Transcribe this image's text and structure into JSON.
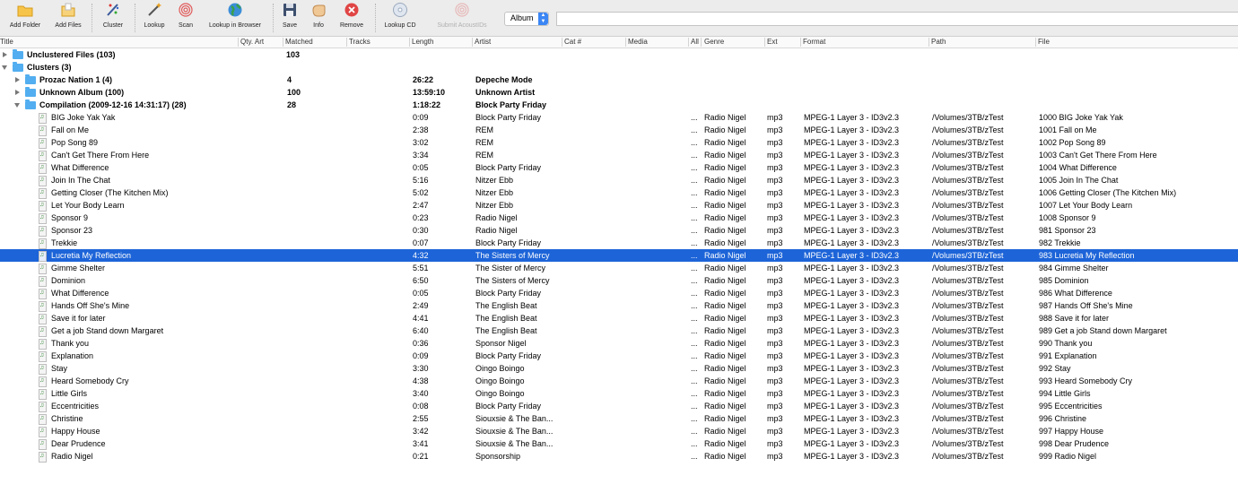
{
  "toolbar": {
    "buttons": [
      {
        "id": "add-folder",
        "label": "Add Folder"
      },
      {
        "id": "add-files",
        "label": "Add Files"
      },
      {
        "id": "cluster",
        "label": "Cluster"
      },
      {
        "id": "lookup",
        "label": "Lookup"
      },
      {
        "id": "scan",
        "label": "Scan"
      },
      {
        "id": "lookup-browser",
        "label": "Lookup in Browser"
      },
      {
        "id": "save",
        "label": "Save"
      },
      {
        "id": "info",
        "label": "Info"
      },
      {
        "id": "remove",
        "label": "Remove"
      },
      {
        "id": "lookup-cd",
        "label": "Lookup CD"
      },
      {
        "id": "submit-acoustids",
        "label": "Submit AcoustIDs"
      }
    ],
    "search_mode": "Album",
    "search_value": ""
  },
  "columns": [
    "Title",
    "Qty. Art",
    "Matched",
    "Tracks",
    "Length",
    "Artist",
    "Cat #",
    "Media",
    "All",
    "Genre",
    "Ext",
    "Format",
    "Path",
    "File"
  ],
  "groups": [
    {
      "title": "Unclustered Files (103)",
      "matched": "103"
    },
    {
      "title": "Clusters (3)"
    },
    {
      "title": "Prozac Nation 1 (4)",
      "qty": "4",
      "length": "26:22",
      "artist": "Depeche Mode"
    },
    {
      "title": "Unknown Album (100)",
      "qty": "100",
      "length": "13:59:10",
      "artist": "Unknown Artist"
    },
    {
      "title": "Compilation (2009-12-16 14:31:17) (28)",
      "qty": "28",
      "length": "1:18:22",
      "artist": "Block Party Friday"
    }
  ],
  "tracks": [
    {
      "title": "BIG Joke Yak Yak",
      "length": "0:09",
      "artist": "Block Party Friday",
      "genre": "Radio Nigel",
      "ext": "mp3",
      "format": "MPEG-1 Layer 3 - ID3v2.3",
      "path": "/Volumes/3TB/zTest",
      "file": "1000 BIG Joke Yak Yak"
    },
    {
      "title": "Fall on Me",
      "length": "2:38",
      "artist": "REM",
      "genre": "Radio Nigel",
      "ext": "mp3",
      "format": "MPEG-1 Layer 3 - ID3v2.3",
      "path": "/Volumes/3TB/zTest",
      "file": "1001 Fall on Me"
    },
    {
      "title": "Pop Song 89",
      "length": "3:02",
      "artist": "REM",
      "genre": "Radio Nigel",
      "ext": "mp3",
      "format": "MPEG-1 Layer 3 - ID3v2.3",
      "path": "/Volumes/3TB/zTest",
      "file": "1002 Pop Song 89"
    },
    {
      "title": "Can't Get There From Here",
      "length": "3:34",
      "artist": "REM",
      "genre": "Radio Nigel",
      "ext": "mp3",
      "format": "MPEG-1 Layer 3 - ID3v2.3",
      "path": "/Volumes/3TB/zTest",
      "file": "1003 Can't Get There From Here"
    },
    {
      "title": "What Difference",
      "length": "0:05",
      "artist": "Block Party Friday",
      "genre": "Radio Nigel",
      "ext": "mp3",
      "format": "MPEG-1 Layer 3 - ID3v2.3",
      "path": "/Volumes/3TB/zTest",
      "file": "1004 What Difference"
    },
    {
      "title": "Join In The Chat",
      "length": "5:16",
      "artist": "Nitzer Ebb",
      "genre": "Radio Nigel",
      "ext": "mp3",
      "format": "MPEG-1 Layer 3 - ID3v2.3",
      "path": "/Volumes/3TB/zTest",
      "file": "1005 Join In The Chat"
    },
    {
      "title": "Getting Closer (The Kitchen Mix)",
      "length": "5:02",
      "artist": "Nitzer Ebb",
      "genre": "Radio Nigel",
      "ext": "mp3",
      "format": "MPEG-1 Layer 3 - ID3v2.3",
      "path": "/Volumes/3TB/zTest",
      "file": "1006 Getting Closer (The Kitchen Mix)"
    },
    {
      "title": "Let Your Body Learn",
      "length": "2:47",
      "artist": "Nitzer Ebb",
      "genre": "Radio Nigel",
      "ext": "mp3",
      "format": "MPEG-1 Layer 3 - ID3v2.3",
      "path": "/Volumes/3TB/zTest",
      "file": "1007 Let Your Body Learn"
    },
    {
      "title": "Sponsor 9",
      "length": "0:23",
      "artist": "Radio Nigel",
      "genre": "Radio Nigel",
      "ext": "mp3",
      "format": "MPEG-1 Layer 3 - ID3v2.3",
      "path": "/Volumes/3TB/zTest",
      "file": "1008 Sponsor 9"
    },
    {
      "title": "Sponsor 23",
      "length": "0:30",
      "artist": "Radio Nigel",
      "genre": "Radio Nigel",
      "ext": "mp3",
      "format": "MPEG-1 Layer 3 - ID3v2.3",
      "path": "/Volumes/3TB/zTest",
      "file": "981 Sponsor 23"
    },
    {
      "title": "Trekkie",
      "length": "0:07",
      "artist": "Block Party Friday",
      "genre": "Radio Nigel",
      "ext": "mp3",
      "format": "MPEG-1 Layer 3 - ID3v2.3",
      "path": "/Volumes/3TB/zTest",
      "file": "982 Trekkie"
    },
    {
      "title": "Lucretia My Reflection",
      "length": "4:32",
      "artist": "The Sisters of Mercy",
      "genre": "Radio Nigel",
      "ext": "mp3",
      "format": "MPEG-1 Layer 3 - ID3v2.3",
      "path": "/Volumes/3TB/zTest",
      "file": "983 Lucretia My Reflection",
      "selected": true
    },
    {
      "title": "Gimme Shelter",
      "length": "5:51",
      "artist": "The Sister of Mercy",
      "genre": "Radio Nigel",
      "ext": "mp3",
      "format": "MPEG-1 Layer 3 - ID3v2.3",
      "path": "/Volumes/3TB/zTest",
      "file": "984 Gimme Shelter"
    },
    {
      "title": "Dominion",
      "length": "6:50",
      "artist": "The Sisters of Mercy",
      "genre": "Radio Nigel",
      "ext": "mp3",
      "format": "MPEG-1 Layer 3 - ID3v2.3",
      "path": "/Volumes/3TB/zTest",
      "file": "985 Dominion"
    },
    {
      "title": "What Difference",
      "length": "0:05",
      "artist": "Block Party Friday",
      "genre": "Radio Nigel",
      "ext": "mp3",
      "format": "MPEG-1 Layer 3 - ID3v2.3",
      "path": "/Volumes/3TB/zTest",
      "file": "986 What Difference"
    },
    {
      "title": "Hands Off She's Mine",
      "length": "2:49",
      "artist": "The English Beat",
      "genre": "Radio Nigel",
      "ext": "mp3",
      "format": "MPEG-1 Layer 3 - ID3v2.3",
      "path": "/Volumes/3TB/zTest",
      "file": "987 Hands Off She's Mine"
    },
    {
      "title": "Save it for later",
      "length": "4:41",
      "artist": "The English Beat",
      "genre": "Radio Nigel",
      "ext": "mp3",
      "format": "MPEG-1 Layer 3 - ID3v2.3",
      "path": "/Volumes/3TB/zTest",
      "file": "988 Save it for later"
    },
    {
      "title": "Get a job Stand down Margaret",
      "length": "6:40",
      "artist": "The English Beat",
      "genre": "Radio Nigel",
      "ext": "mp3",
      "format": "MPEG-1 Layer 3 - ID3v2.3",
      "path": "/Volumes/3TB/zTest",
      "file": "989 Get a job Stand down Margaret"
    },
    {
      "title": "Thank you",
      "length": "0:36",
      "artist": "Sponsor Nigel",
      "genre": "Radio Nigel",
      "ext": "mp3",
      "format": "MPEG-1 Layer 3 - ID3v2.3",
      "path": "/Volumes/3TB/zTest",
      "file": "990 Thank you"
    },
    {
      "title": "Explanation",
      "length": "0:09",
      "artist": "Block Party Friday",
      "genre": "Radio Nigel",
      "ext": "mp3",
      "format": "MPEG-1 Layer 3 - ID3v2.3",
      "path": "/Volumes/3TB/zTest",
      "file": "991 Explanation"
    },
    {
      "title": "Stay",
      "length": "3:30",
      "artist": "Oingo Boingo",
      "genre": "Radio Nigel",
      "ext": "mp3",
      "format": "MPEG-1 Layer 3 - ID3v2.3",
      "path": "/Volumes/3TB/zTest",
      "file": "992 Stay"
    },
    {
      "title": "Heard Somebody Cry",
      "length": "4:38",
      "artist": "Oingo Boingo",
      "genre": "Radio Nigel",
      "ext": "mp3",
      "format": "MPEG-1 Layer 3 - ID3v2.3",
      "path": "/Volumes/3TB/zTest",
      "file": "993 Heard Somebody Cry"
    },
    {
      "title": "Little Girls",
      "length": "3:40",
      "artist": "Oingo Boingo",
      "genre": "Radio Nigel",
      "ext": "mp3",
      "format": "MPEG-1 Layer 3 - ID3v2.3",
      "path": "/Volumes/3TB/zTest",
      "file": "994 Little Girls"
    },
    {
      "title": "Eccentricities",
      "length": "0:08",
      "artist": "Block Party Friday",
      "genre": "Radio Nigel",
      "ext": "mp3",
      "format": "MPEG-1 Layer 3 - ID3v2.3",
      "path": "/Volumes/3TB/zTest",
      "file": "995 Eccentricities"
    },
    {
      "title": "Christine",
      "length": "2:55",
      "artist": "Siouxsie & The Ban...",
      "genre": "Radio Nigel",
      "ext": "mp3",
      "format": "MPEG-1 Layer 3 - ID3v2.3",
      "path": "/Volumes/3TB/zTest",
      "file": "996 Christine"
    },
    {
      "title": "Happy House",
      "length": "3:42",
      "artist": "Siouxsie & The Ban...",
      "genre": "Radio Nigel",
      "ext": "mp3",
      "format": "MPEG-1 Layer 3 - ID3v2.3",
      "path": "/Volumes/3TB/zTest",
      "file": "997 Happy House"
    },
    {
      "title": "Dear Prudence",
      "length": "3:41",
      "artist": "Siouxsie & The Ban...",
      "genre": "Radio Nigel",
      "ext": "mp3",
      "format": "MPEG-1 Layer 3 - ID3v2.3",
      "path": "/Volumes/3TB/zTest",
      "file": "998 Dear Prudence"
    },
    {
      "title": "Radio Nigel",
      "length": "0:21",
      "artist": "Sponsorship",
      "genre": "Radio Nigel",
      "ext": "mp3",
      "format": "MPEG-1 Layer 3 - ID3v2.3",
      "path": "/Volumes/3TB/zTest",
      "file": "999 Radio Nigel"
    }
  ],
  "ellipsis": "...",
  "colors": {
    "selection": "#1d64d8",
    "folder": "#52aef0",
    "toolbar": "#ececec"
  }
}
